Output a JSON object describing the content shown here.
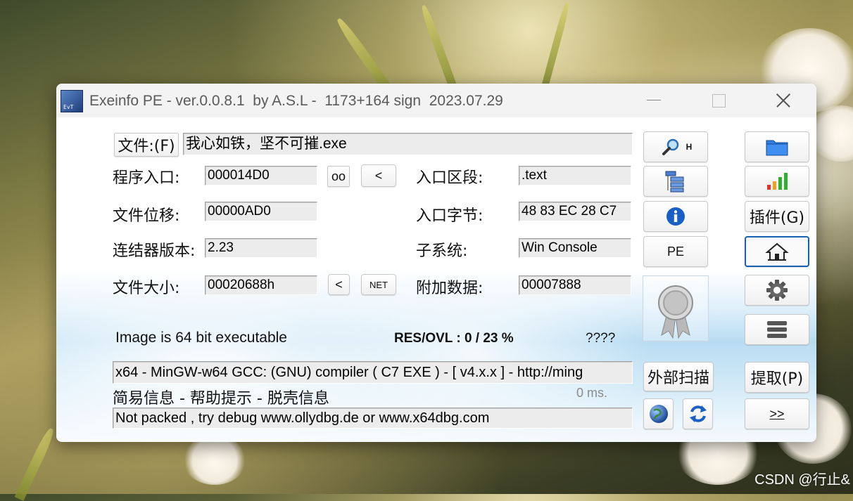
{
  "window": {
    "title": "Exeinfo PE - ver.0.0.8.1  by A.S.L -  1173+164 sign  2023.07.29",
    "icon_text": "EvT"
  },
  "file": {
    "button_label": "文件:(F)",
    "name": "我心如铁，坚不可摧.exe"
  },
  "info": {
    "entry_point_label": "程序入口:",
    "entry_point_value": "000014D0",
    "oo_label": "oo",
    "lt_label": "<",
    "file_offset_label": "文件位移:",
    "file_offset_value": "00000AD0",
    "linker_label": "连结器版本:",
    "linker_value": "2.23",
    "file_size_label": "文件大小:",
    "file_size_value": "00020688h",
    "size_lt_label": "<",
    "net_label": "NET",
    "ep_section_label": "入口区段:",
    "ep_section_value": ".text",
    "ep_bytes_label": "入口字节:",
    "ep_bytes_value": "48 83 EC 28 C7",
    "subsystem_label": "子系统:",
    "subsystem_value": "Win Console",
    "overlay_label": "附加数据:",
    "overlay_value": "00007888"
  },
  "status": {
    "image_type": "Image is 64 bit executable",
    "res_ovl": "RES/OVL : 0 / 23 %",
    "unknown": "????",
    "compiler": " x64 - MinGW-w64 GCC: (GNU) compiler ( C7 EXE ) - [ v4.x.x ]  - http://ming",
    "help_line": "简易信息 - 帮助提示 - 脱壳信息",
    "time": "0 ms.",
    "packed_info": "Not packed , try debug www.ollydbg.de or www.x64dbg.com"
  },
  "right_panel": {
    "search_h_label": "H",
    "pe_label": "PE",
    "scan_label": "外部扫描",
    "plugins_label": "插件(G)",
    "extract_label": "提取(P)",
    "more_label": ">>"
  },
  "icons": [
    "magnifier-icon",
    "tree-icon",
    "info-icon",
    "folder-icon",
    "signal-icon",
    "home-icon",
    "gear-icon",
    "stack-icon",
    "globe-icon",
    "refresh-icon",
    "medal-icon"
  ],
  "watermark": "CSDN @行止&"
}
